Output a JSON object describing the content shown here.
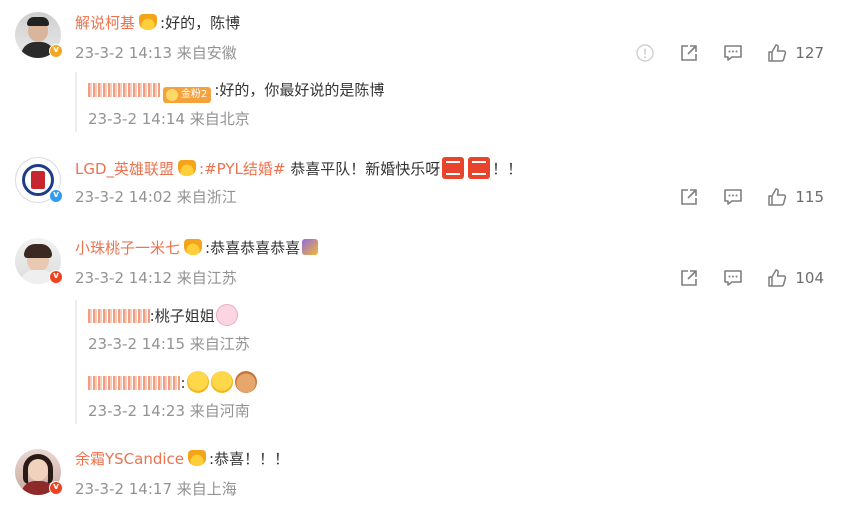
{
  "comments": [
    {
      "user": "解说柯基",
      "text": ":好的，陈博",
      "time": "23-3-2 14:13",
      "location": "来自安徽",
      "likes": "127",
      "replies": [
        {
          "user": "",
          "badge": "金粉2",
          "text": ":好的，你最好说的是陈博",
          "time": "23-3-2 14:14",
          "location": "来自北京"
        }
      ]
    },
    {
      "user": "LGD_英雄联盟",
      "tag": ":#PYL结婚#",
      "text": " 恭喜平队！新婚快乐呀",
      "text_end": "！！",
      "time": "23-3-2 14:02",
      "location": "来自浙江",
      "likes": "115"
    },
    {
      "user": "小珠桃子一米七",
      "text": ":恭喜恭喜恭喜",
      "time": "23-3-2 14:12",
      "location": "来自江苏",
      "likes": "104",
      "replies": [
        {
          "user": "",
          "text": ":桃子姐姐",
          "time": "23-3-2 14:15",
          "location": "来自江苏"
        },
        {
          "user": "",
          "text": ":",
          "time": "23-3-2 14:23",
          "location": "来自河南"
        }
      ]
    },
    {
      "user": "余霜YSCandice",
      "text": ":恭喜！！！",
      "time": "23-3-2 14:17",
      "location": "来自上海"
    }
  ],
  "icons": {
    "report": "report-icon",
    "share": "share-icon",
    "comment": "comment-icon",
    "like": "like-icon"
  },
  "colors": {
    "username": "#eb7350",
    "meta": "#939393",
    "icon": "#7f7f7f"
  }
}
